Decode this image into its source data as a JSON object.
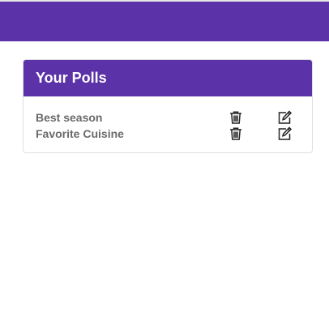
{
  "card": {
    "title": "Your Polls"
  },
  "polls": [
    {
      "name": "Best season",
      "delete_icon": "trash-icon",
      "edit_icon": "edit-icon"
    },
    {
      "name": "Favorite Cuisine",
      "delete_icon": "trash-icon",
      "edit_icon": "edit-icon"
    }
  ],
  "colors": {
    "brand": "#5b32a8",
    "text_muted": "#6a6a6a"
  }
}
